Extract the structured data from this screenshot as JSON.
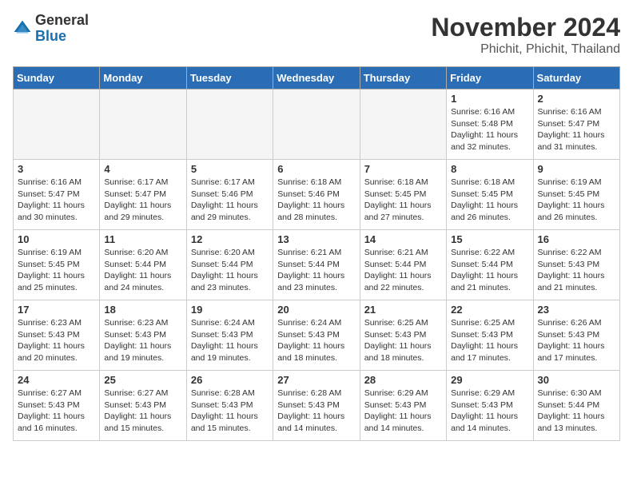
{
  "header": {
    "logo_general": "General",
    "logo_blue": "Blue",
    "month_title": "November 2024",
    "location": "Phichit, Phichit, Thailand"
  },
  "days_of_week": [
    "Sunday",
    "Monday",
    "Tuesday",
    "Wednesday",
    "Thursday",
    "Friday",
    "Saturday"
  ],
  "weeks": [
    [
      {
        "day": "",
        "empty": true
      },
      {
        "day": "",
        "empty": true
      },
      {
        "day": "",
        "empty": true
      },
      {
        "day": "",
        "empty": true
      },
      {
        "day": "",
        "empty": true
      },
      {
        "day": "1",
        "sunrise": "6:16 AM",
        "sunset": "5:48 PM",
        "daylight": "11 hours and 32 minutes."
      },
      {
        "day": "2",
        "sunrise": "6:16 AM",
        "sunset": "5:47 PM",
        "daylight": "11 hours and 31 minutes."
      }
    ],
    [
      {
        "day": "3",
        "sunrise": "6:16 AM",
        "sunset": "5:47 PM",
        "daylight": "11 hours and 30 minutes."
      },
      {
        "day": "4",
        "sunrise": "6:17 AM",
        "sunset": "5:47 PM",
        "daylight": "11 hours and 29 minutes."
      },
      {
        "day": "5",
        "sunrise": "6:17 AM",
        "sunset": "5:46 PM",
        "daylight": "11 hours and 29 minutes."
      },
      {
        "day": "6",
        "sunrise": "6:18 AM",
        "sunset": "5:46 PM",
        "daylight": "11 hours and 28 minutes."
      },
      {
        "day": "7",
        "sunrise": "6:18 AM",
        "sunset": "5:45 PM",
        "daylight": "11 hours and 27 minutes."
      },
      {
        "day": "8",
        "sunrise": "6:18 AM",
        "sunset": "5:45 PM",
        "daylight": "11 hours and 26 minutes."
      },
      {
        "day": "9",
        "sunrise": "6:19 AM",
        "sunset": "5:45 PM",
        "daylight": "11 hours and 26 minutes."
      }
    ],
    [
      {
        "day": "10",
        "sunrise": "6:19 AM",
        "sunset": "5:45 PM",
        "daylight": "11 hours and 25 minutes."
      },
      {
        "day": "11",
        "sunrise": "6:20 AM",
        "sunset": "5:44 PM",
        "daylight": "11 hours and 24 minutes."
      },
      {
        "day": "12",
        "sunrise": "6:20 AM",
        "sunset": "5:44 PM",
        "daylight": "11 hours and 23 minutes."
      },
      {
        "day": "13",
        "sunrise": "6:21 AM",
        "sunset": "5:44 PM",
        "daylight": "11 hours and 23 minutes."
      },
      {
        "day": "14",
        "sunrise": "6:21 AM",
        "sunset": "5:44 PM",
        "daylight": "11 hours and 22 minutes."
      },
      {
        "day": "15",
        "sunrise": "6:22 AM",
        "sunset": "5:44 PM",
        "daylight": "11 hours and 21 minutes."
      },
      {
        "day": "16",
        "sunrise": "6:22 AM",
        "sunset": "5:43 PM",
        "daylight": "11 hours and 21 minutes."
      }
    ],
    [
      {
        "day": "17",
        "sunrise": "6:23 AM",
        "sunset": "5:43 PM",
        "daylight": "11 hours and 20 minutes."
      },
      {
        "day": "18",
        "sunrise": "6:23 AM",
        "sunset": "5:43 PM",
        "daylight": "11 hours and 19 minutes."
      },
      {
        "day": "19",
        "sunrise": "6:24 AM",
        "sunset": "5:43 PM",
        "daylight": "11 hours and 19 minutes."
      },
      {
        "day": "20",
        "sunrise": "6:24 AM",
        "sunset": "5:43 PM",
        "daylight": "11 hours and 18 minutes."
      },
      {
        "day": "21",
        "sunrise": "6:25 AM",
        "sunset": "5:43 PM",
        "daylight": "11 hours and 18 minutes."
      },
      {
        "day": "22",
        "sunrise": "6:25 AM",
        "sunset": "5:43 PM",
        "daylight": "11 hours and 17 minutes."
      },
      {
        "day": "23",
        "sunrise": "6:26 AM",
        "sunset": "5:43 PM",
        "daylight": "11 hours and 17 minutes."
      }
    ],
    [
      {
        "day": "24",
        "sunrise": "6:27 AM",
        "sunset": "5:43 PM",
        "daylight": "11 hours and 16 minutes."
      },
      {
        "day": "25",
        "sunrise": "6:27 AM",
        "sunset": "5:43 PM",
        "daylight": "11 hours and 15 minutes."
      },
      {
        "day": "26",
        "sunrise": "6:28 AM",
        "sunset": "5:43 PM",
        "daylight": "11 hours and 15 minutes."
      },
      {
        "day": "27",
        "sunrise": "6:28 AM",
        "sunset": "5:43 PM",
        "daylight": "11 hours and 14 minutes."
      },
      {
        "day": "28",
        "sunrise": "6:29 AM",
        "sunset": "5:43 PM",
        "daylight": "11 hours and 14 minutes."
      },
      {
        "day": "29",
        "sunrise": "6:29 AM",
        "sunset": "5:43 PM",
        "daylight": "11 hours and 14 minutes."
      },
      {
        "day": "30",
        "sunrise": "6:30 AM",
        "sunset": "5:44 PM",
        "daylight": "11 hours and 13 minutes."
      }
    ]
  ],
  "labels": {
    "sunrise": "Sunrise:",
    "sunset": "Sunset:",
    "daylight": "Daylight:"
  }
}
